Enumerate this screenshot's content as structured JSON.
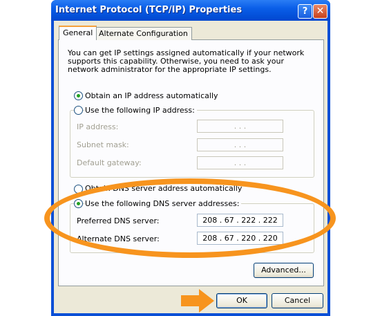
{
  "window": {
    "title": "Internet Protocol (TCP/IP) Properties",
    "help_label": "?",
    "close_label": "✕"
  },
  "tabs": [
    {
      "label": "General",
      "selected": true
    },
    {
      "label": "Alternate Configuration",
      "selected": false
    }
  ],
  "intro": "You can get IP settings assigned automatically if your network supports this capability. Otherwise, you need to ask your network administrator for the appropriate IP settings.",
  "ip": {
    "auto_label": "Obtain an IP address automatically",
    "auto_selected": true,
    "manual_label": "Use the following IP address:",
    "manual_selected": false,
    "fields": [
      {
        "label": "IP address:",
        "value": ".    .    ."
      },
      {
        "label": "Subnet mask:",
        "value": ".    .    ."
      },
      {
        "label": "Default gateway:",
        "value": ".    .    ."
      }
    ]
  },
  "dns": {
    "auto_label": "Obtain DNS server address automatically",
    "auto_selected": false,
    "manual_label": "Use the following DNS server addresses:",
    "manual_selected": true,
    "preferred_label": "Preferred DNS server:",
    "preferred_value": "208 . 67 . 222 . 222",
    "alternate_label": "Alternate DNS server:",
    "alternate_value": "208 . 67 . 220 . 220"
  },
  "buttons": {
    "advanced": "Advanced...",
    "ok": "OK",
    "cancel": "Cancel"
  },
  "colors": {
    "highlight_orange": "#f7941e",
    "titlebar_blue": "#0a5ee8",
    "radio_dot": "#21a121"
  }
}
